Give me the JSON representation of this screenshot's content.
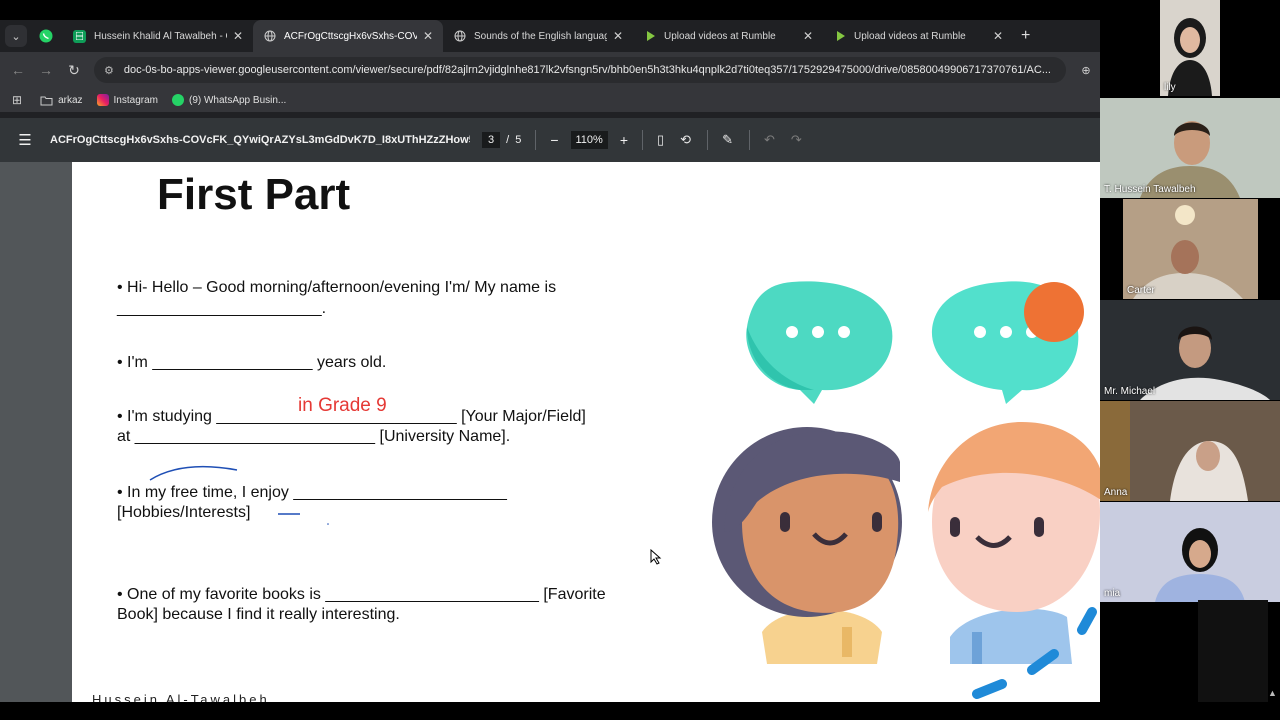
{
  "browser": {
    "tabs": [
      {
        "label": "Hussein Khalid Al Tawalbeh - G",
        "icon": "sheets-icon",
        "color": "#0f9d58"
      },
      {
        "label": "ACFrOgCttscgHx6vSxhs-COVcF",
        "icon": "globe-icon",
        "color": "#aaaaaa"
      },
      {
        "label": "Sounds of the English language",
        "icon": "globe-icon",
        "color": "#aaaaaa"
      },
      {
        "label": "Upload videos at Rumble",
        "icon": "rumble-icon",
        "color": "#85c742"
      },
      {
        "label": "Upload videos at Rumble",
        "icon": "rumble-icon",
        "color": "#85c742"
      }
    ],
    "url": "doc-0s-bo-apps-viewer.googleusercontent.com/viewer/secure/pdf/82ajlrn2vjidglnhe817lk2vfsngn5rv/bhb0en5h3t3hku4qnplk2d7ti0teq357/1752929475000/drive/08580049906717370761/AC...",
    "bookmarks": [
      {
        "label": "arkaz",
        "icon": "folder-icon"
      },
      {
        "label": "Instagram",
        "icon": "instagram-icon"
      },
      {
        "label": "(9) WhatsApp Busin...",
        "icon": "whatsapp-icon"
      }
    ]
  },
  "pdf": {
    "title": "ACFrOgCttscgHx6vSxhs-COVcFK_QYwiQrAZYsL3mGdDvK7D_I8xUThHZzZHow51...",
    "page_current": "3",
    "page_sep": "/",
    "page_total": "5",
    "zoom": "110%"
  },
  "slide": {
    "title": "First Part",
    "lines": [
      "•  Hi- Hello – Good morning/afternoon/evening I'm/ My name is",
      "_______________________.",
      "•  I'm __________________ years old.",
      "•  I'm studying ___________________________ [Your Major/Field]",
      "at ___________________________ [University Name].",
      "•   In my free time, I enjoy ________________________",
      "[Hobbies/Interests]",
      "•  One of my favorite books is ________________________ [Favorite",
      "Book] because I find it really interesting."
    ],
    "annotation": "in Grade 9",
    "footer": "Hussein Al-Tawalbeh"
  },
  "participants": [
    {
      "name": "lily",
      "bg": "#d9d4cc"
    },
    {
      "name": "T. Hussein Tawalbeh",
      "bg": "#bfc8bf"
    },
    {
      "name": "Carter",
      "bg": "#b59f86"
    },
    {
      "name": "Mr. Michael",
      "bg": "#2b2f33"
    },
    {
      "name": "Anna",
      "bg": "#6b5a4a"
    },
    {
      "name": "mia",
      "bg": "#c9cde0"
    }
  ]
}
